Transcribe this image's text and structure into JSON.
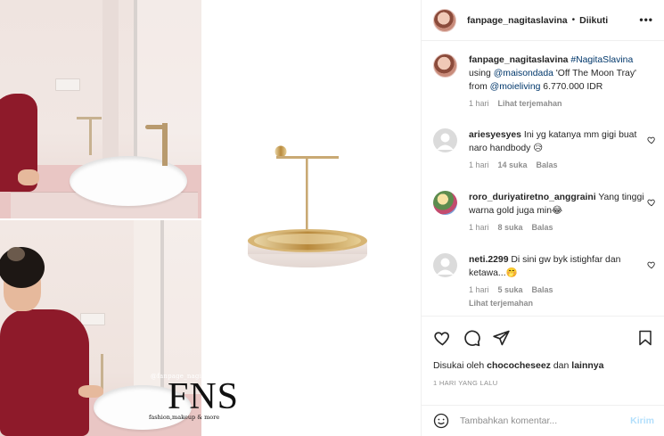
{
  "post": {
    "author": "fanpage_nagitaslavina",
    "follow_status": "Diikuti",
    "more_label": "•••"
  },
  "caption": {
    "username": "fanpage_nagitaslavina",
    "hashtag": "#NagitaSlavina",
    "text1": "using ",
    "mention1": "@maisondada",
    "text2": " 'Off The Moon Tray' from ",
    "mention2": "@moieliving",
    "text3": " 6.770.000 IDR",
    "time": "1 hari",
    "translate": "Lihat terjemahan"
  },
  "comments": [
    {
      "username": "ariesyesyes",
      "text": "Ini yg katanya mm gigi buat naro handbody 😥",
      "time": "1 hari",
      "likes": "14 suka",
      "reply": "Balas"
    },
    {
      "username": "roro_duriyatiretno_anggraini",
      "text": "Yang tinggi warna gold juga min😂",
      "time": "1 hari",
      "likes": "8 suka",
      "reply": "Balas"
    },
    {
      "username": "neti.2299",
      "text": "Di sini gw byk istighfar dan ketawa...🤭",
      "time": "1 hari",
      "likes": "5 suka",
      "reply": "Balas",
      "translate": "Lihat terjemahan"
    }
  ],
  "actions": {
    "liked_prefix": "Disukai oleh ",
    "liked_user": "chococheseez",
    "liked_mid": " dan ",
    "liked_others": "lainnya",
    "timestamp": "1 HARI YANG LALU"
  },
  "comment_box": {
    "placeholder": "Tambahkan komentar...",
    "send": "Kirim"
  },
  "watermark": {
    "handle": "@fanpage_nagitaslavina",
    "logo": "FNS",
    "subtitle": "fashion,makeup & more"
  },
  "colors": {
    "link": "#00376b",
    "muted": "#8e8e8e",
    "send_disabled": "#b2dffc",
    "gold": "#c9a25a"
  }
}
